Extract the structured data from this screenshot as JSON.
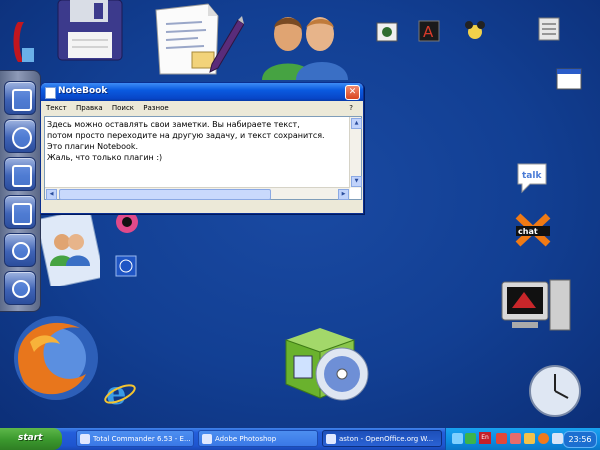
{
  "window": {
    "title": "NoteBook",
    "close": "✕",
    "menu": [
      "Текст",
      "Правка",
      "Поиск",
      "Разное"
    ],
    "help": "?",
    "text": "Здесь можно оставлять свои заметки. Вы набираете текст,\nпотом просто переходите на другую задачу, и текст сохранится.\nЭто плагин Notebook.\nЖаль, что только плагин :)"
  },
  "taskbar": {
    "start": "start",
    "buttons": [
      {
        "label": "Total Commander 6.53 - E..."
      },
      {
        "label": "Adobe Photoshop"
      },
      {
        "label": "aston - OpenOffice.org W..."
      }
    ],
    "tray_lang": "En",
    "clock": "23:56"
  },
  "colors": {
    "desktop": "#123f93",
    "title_bar": "#0a5ae0",
    "taskbar": "#245edb",
    "start_green": "#3c9a2f"
  }
}
